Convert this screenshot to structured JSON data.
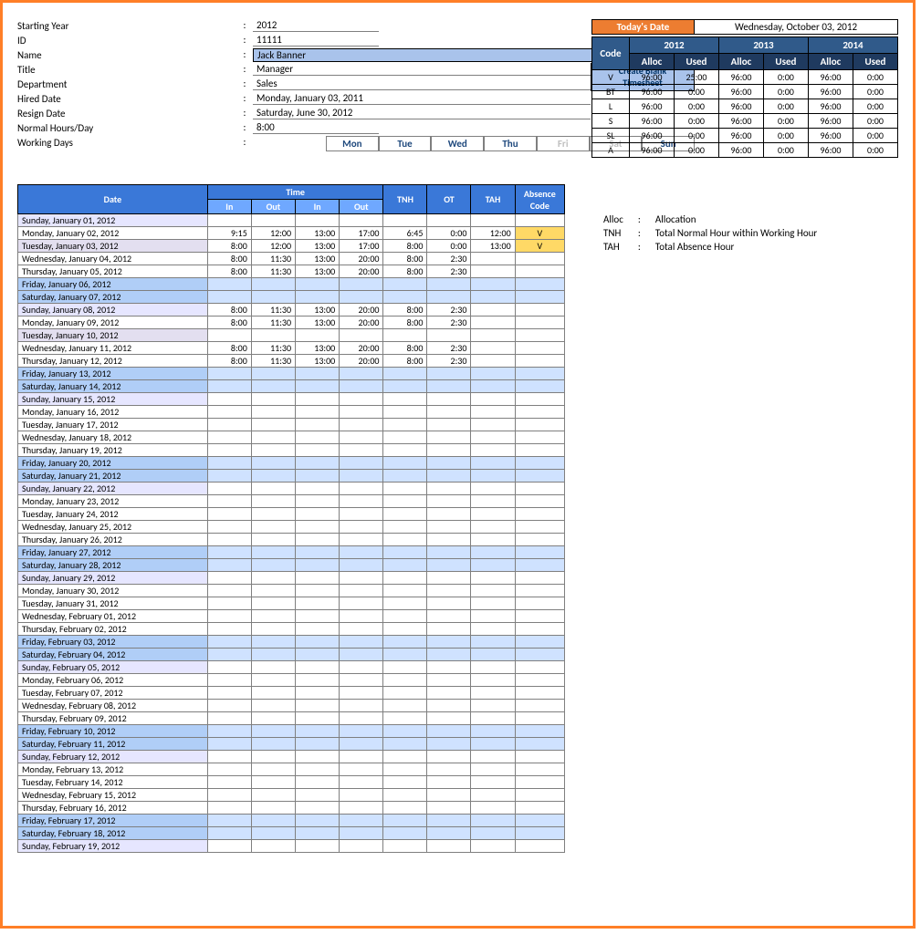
{
  "employee": {
    "labels": {
      "startingYear": "Starting Year",
      "id": "ID",
      "name": "Name",
      "title": "Title",
      "department": "Department",
      "hired": "Hired Date",
      "resign": "Resign Date",
      "normalHours": "Normal Hours/Day",
      "workingDays": "Working Days"
    },
    "values": {
      "startingYear": "2012",
      "id": "11111",
      "name": "Jack Banner",
      "title": "Manager",
      "department": "Sales",
      "hired": "Monday, January 03, 2011",
      "resign": "Saturday, June 30, 2012",
      "normalHours": "8:00"
    },
    "nav": ">>",
    "createBtn": [
      "Create Blank",
      "Timesheet"
    ],
    "days": [
      {
        "d": "Mon",
        "on": true
      },
      {
        "d": "Tue",
        "on": true
      },
      {
        "d": "Wed",
        "on": true
      },
      {
        "d": "Thu",
        "on": true
      },
      {
        "d": "Fri",
        "on": false
      },
      {
        "d": "Sat",
        "on": false
      },
      {
        "d": "Sun",
        "on": true
      }
    ]
  },
  "today": {
    "label": "Today's Date",
    "value": "Wednesday, October 03, 2012"
  },
  "codes": {
    "codeHdr": "Code",
    "years": [
      "2012",
      "2013",
      "2014"
    ],
    "sub": [
      "Alloc",
      "Used"
    ],
    "rows": [
      {
        "c": "V",
        "y": [
          [
            "96:00",
            "25:00"
          ],
          [
            "96:00",
            "0:00"
          ],
          [
            "96:00",
            "0:00"
          ]
        ]
      },
      {
        "c": "BT",
        "y": [
          [
            "96:00",
            "0:00"
          ],
          [
            "96:00",
            "0:00"
          ],
          [
            "96:00",
            "0:00"
          ]
        ]
      },
      {
        "c": "L",
        "y": [
          [
            "96:00",
            "0:00"
          ],
          [
            "96:00",
            "0:00"
          ],
          [
            "96:00",
            "0:00"
          ]
        ]
      },
      {
        "c": "S",
        "y": [
          [
            "96:00",
            "0:00"
          ],
          [
            "96:00",
            "0:00"
          ],
          [
            "96:00",
            "0:00"
          ]
        ]
      },
      {
        "c": "SL",
        "y": [
          [
            "96:00",
            "0:00"
          ],
          [
            "96:00",
            "0:00"
          ],
          [
            "96:00",
            "0:00"
          ]
        ]
      },
      {
        "c": "A",
        "y": [
          [
            "96:00",
            "0:00"
          ],
          [
            "96:00",
            "0:00"
          ],
          [
            "96:00",
            "0:00"
          ]
        ]
      }
    ]
  },
  "legend": [
    {
      "k": "Alloc",
      "v": "Allocation"
    },
    {
      "k": "TNH",
      "v": "Total Normal Hour within Working Hour"
    },
    {
      "k": "TAH",
      "v": "Total Absence Hour"
    }
  ],
  "timesheet": {
    "hdr": {
      "date": "Date",
      "time": "Time",
      "in": "In",
      "out": "Out",
      "tnh": "TNH",
      "ot": "OT",
      "tah": "TAH",
      "abs": "Absence Code"
    },
    "rows": [
      {
        "date": "Sunday, January 01, 2012",
        "dow": "sun"
      },
      {
        "date": "Monday, January 02, 2012",
        "dow": "mon",
        "in1": "9:15",
        "out1": "12:00",
        "in2": "13:00",
        "out2": "17:00",
        "tnh": "6:45",
        "ot": "0:00",
        "tah": "12:00",
        "abs": "V"
      },
      {
        "date": "Tuesday, January 03, 2012",
        "dow": "tue",
        "in1": "8:00",
        "out1": "12:00",
        "in2": "13:00",
        "out2": "17:00",
        "tnh": "8:00",
        "ot": "0:00",
        "tah": "13:00",
        "abs": "V"
      },
      {
        "date": "Wednesday, January 04, 2012",
        "dow": "wed",
        "in1": "8:00",
        "out1": "11:30",
        "in2": "13:00",
        "out2": "20:00",
        "tnh": "8:00",
        "ot": "2:30"
      },
      {
        "date": "Thursday, January 05, 2012",
        "dow": "thu",
        "in1": "8:00",
        "out1": "11:30",
        "in2": "13:00",
        "out2": "20:00",
        "tnh": "8:00",
        "ot": "2:30"
      },
      {
        "date": "Friday, January 06, 2012",
        "dow": "fri"
      },
      {
        "date": "Saturday, January 07, 2012",
        "dow": "sat"
      },
      {
        "date": "Sunday, January 08, 2012",
        "dow": "sun",
        "in1": "8:00",
        "out1": "11:30",
        "in2": "13:00",
        "out2": "20:00",
        "tnh": "8:00",
        "ot": "2:30"
      },
      {
        "date": "Monday, January 09, 2012",
        "dow": "mon",
        "in1": "8:00",
        "out1": "11:30",
        "in2": "13:00",
        "out2": "20:00",
        "tnh": "8:00",
        "ot": "2:30"
      },
      {
        "date": "Tuesday, January 10, 2012",
        "dow": "tue"
      },
      {
        "date": "Wednesday, January 11, 2012",
        "dow": "wed",
        "in1": "8:00",
        "out1": "11:30",
        "in2": "13:00",
        "out2": "20:00",
        "tnh": "8:00",
        "ot": "2:30"
      },
      {
        "date": "Thursday, January 12, 2012",
        "dow": "thu",
        "in1": "8:00",
        "out1": "11:30",
        "in2": "13:00",
        "out2": "20:00",
        "tnh": "8:00",
        "ot": "2:30"
      },
      {
        "date": "Friday, January 13, 2012",
        "dow": "fri"
      },
      {
        "date": "Saturday, January 14, 2012",
        "dow": "sat"
      },
      {
        "date": "Sunday, January 15, 2012",
        "dow": "sun"
      },
      {
        "date": "Monday, January 16, 2012",
        "dow": "mon"
      },
      {
        "date": "Tuesday, January 17, 2012",
        "dow": "tue2"
      },
      {
        "date": "Wednesday, January 18, 2012",
        "dow": "wed"
      },
      {
        "date": "Thursday, January 19, 2012",
        "dow": "thu"
      },
      {
        "date": "Friday, January 20, 2012",
        "dow": "fri"
      },
      {
        "date": "Saturday, January 21, 2012",
        "dow": "sat"
      },
      {
        "date": "Sunday, January 22, 2012",
        "dow": "sun"
      },
      {
        "date": "Monday, January 23, 2012",
        "dow": "mon"
      },
      {
        "date": "Tuesday, January 24, 2012",
        "dow": "tue2"
      },
      {
        "date": "Wednesday, January 25, 2012",
        "dow": "wed"
      },
      {
        "date": "Thursday, January 26, 2012",
        "dow": "thu"
      },
      {
        "date": "Friday, January 27, 2012",
        "dow": "fri"
      },
      {
        "date": "Saturday, January 28, 2012",
        "dow": "sat"
      },
      {
        "date": "Sunday, January 29, 2012",
        "dow": "sun"
      },
      {
        "date": "Monday, January 30, 2012",
        "dow": "mon"
      },
      {
        "date": "Tuesday, January 31, 2012",
        "dow": "tue2"
      },
      {
        "date": "Wednesday, February 01, 2012",
        "dow": "wed"
      },
      {
        "date": "Thursday, February 02, 2012",
        "dow": "thu"
      },
      {
        "date": "Friday, February 03, 2012",
        "dow": "fri"
      },
      {
        "date": "Saturday, February 04, 2012",
        "dow": "sat"
      },
      {
        "date": "Sunday, February 05, 2012",
        "dow": "sun"
      },
      {
        "date": "Monday, February 06, 2012",
        "dow": "mon"
      },
      {
        "date": "Tuesday, February 07, 2012",
        "dow": "tue2"
      },
      {
        "date": "Wednesday, February 08, 2012",
        "dow": "wed"
      },
      {
        "date": "Thursday, February 09, 2012",
        "dow": "thu"
      },
      {
        "date": "Friday, February 10, 2012",
        "dow": "fri"
      },
      {
        "date": "Saturday, February 11, 2012",
        "dow": "sat"
      },
      {
        "date": "Sunday, February 12, 2012",
        "dow": "sun"
      },
      {
        "date": "Monday, February 13, 2012",
        "dow": "mon"
      },
      {
        "date": "Tuesday, February 14, 2012",
        "dow": "tue2"
      },
      {
        "date": "Wednesday, February 15, 2012",
        "dow": "wed"
      },
      {
        "date": "Thursday, February 16, 2012",
        "dow": "thu"
      },
      {
        "date": "Friday, February 17, 2012",
        "dow": "fri"
      },
      {
        "date": "Saturday, February 18, 2012",
        "dow": "sat"
      },
      {
        "date": "Sunday, February 19, 2012",
        "dow": "sun"
      }
    ]
  }
}
